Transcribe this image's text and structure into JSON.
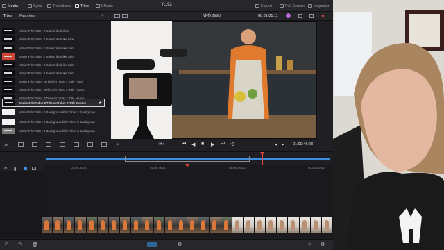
{
  "topbar": {
    "items": [
      {
        "label": "Media"
      },
      {
        "label": "Sync"
      },
      {
        "label": "Transitions"
      },
      {
        "label": "Titles"
      },
      {
        "label": "Effects"
      }
    ],
    "project_title": "Yt192",
    "right_items": [
      {
        "label": "Export"
      },
      {
        "label": "Full Screen"
      },
      {
        "label": "Inspector"
      }
    ]
  },
  "library": {
    "tabs": [
      "Titles",
      "Favorites"
    ],
    "items": [
      {
        "label": "MotionFilmTuber 2 Subscribe/Likes"
      },
      {
        "label": "MotionFilmTuber 2 Subscribe/Like Like"
      },
      {
        "label": "MotionFilmTuber 2 Subscribe/Like Sub"
      },
      {
        "label": "MotionFilmTuber 2 Subscribe/Like Sub"
      },
      {
        "label": "MotionFilmTuber 2 Subscribe/Like Sub"
      },
      {
        "label": "MotionFilmTuber 2 Subscribe/Like Sub"
      },
      {
        "label": "MotionFilmTuber 2/Titles/inTuber 2 Title Fluid"
      },
      {
        "label": "MotionFilmTuber 2/Titles/inTuber 2 Title Frame"
      },
      {
        "label": "MotionFilmTuber 2/Titles/inTuber 2 Title Name"
      },
      {
        "label": "MotionFilmTuber 2/Titles/inTuber 2 Title Search"
      },
      {
        "label": "MotionFilmTuber 3 Backgrounds/inTuber 3 Backgroun"
      },
      {
        "label": "MotionFilmTuber 3 Backgrounds/inTuber 3 Backgroun"
      },
      {
        "label": "MotionFilmTuber 3 Backgrounds/inTuber 3 Backgroun"
      }
    ],
    "selected_index": 9
  },
  "viewer": {
    "title": "Mvfx tests",
    "timecode_top": "00:01:01:11",
    "timecode_transport": "01:00:46:23"
  },
  "timeline": {
    "ruler_labels": [
      "01:00:44:00",
      "01:00:46:00",
      "01:00:48:00",
      "01:00:50:00"
    ],
    "playhead_fraction": 0.5
  },
  "colors": {
    "accent_red": "#e5473b",
    "accent_blue": "#3a8fe0",
    "panel_bg": "#1d1d21"
  }
}
